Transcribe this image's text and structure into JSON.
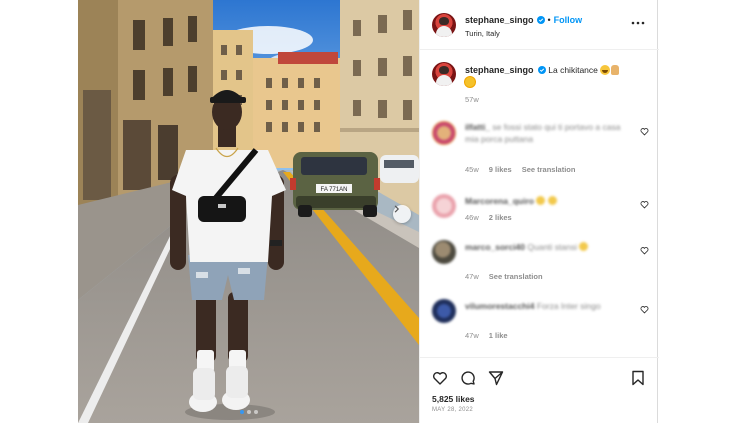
{
  "post": {
    "author": "stephane_singo",
    "follow_label": "Follow",
    "separator": "•",
    "location": "Turin, Italy",
    "caption_text": "La chikitance",
    "caption_age": "57w",
    "likes": "5,825 likes",
    "date": "MAY 28, 2022"
  },
  "license_plate": "FA 771AN",
  "comments": [
    {
      "user": "ilfatti_",
      "text": "se fossi stato qui ti portavo a casa mia porca puttana",
      "age": "45w",
      "likes": "9 likes",
      "action": "See translation"
    },
    {
      "user": "Marcorena_quiro",
      "text": "",
      "age": "46w",
      "likes": "2 likes",
      "action": ""
    },
    {
      "user": "marco_sorci40",
      "text": "Quanti stansi",
      "age": "47w",
      "likes": "",
      "action": "See translation"
    },
    {
      "user": "vilumorestacchi4",
      "text": "Forza Inter singo",
      "age": "47w",
      "likes": "1 like",
      "action": ""
    }
  ],
  "icons": {
    "verified": "verified-badge-icon",
    "more": "more-options-icon",
    "heart": "heart-icon",
    "comment": "comment-icon",
    "share": "share-icon",
    "save": "bookmark-icon",
    "next": "chevron-right-icon"
  },
  "colors": {
    "link": "#0095f6",
    "verified": "#0095f6",
    "text": "#262626",
    "muted": "#8e8e8e",
    "road_line": "#e7a91c"
  }
}
